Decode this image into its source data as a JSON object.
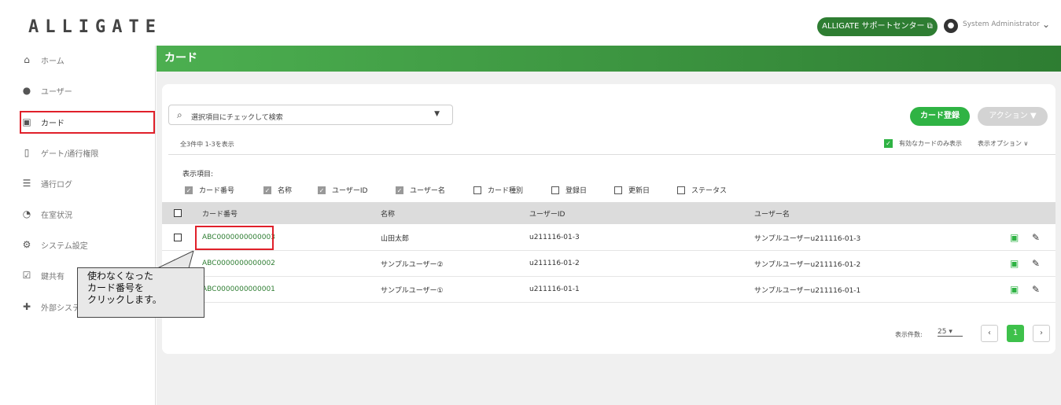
{
  "app": {
    "logo": "ALLIGATE",
    "support": "ALLIGATE サポートセンター ⧉",
    "user_name": "System Administrator"
  },
  "sidebar": {
    "items": [
      {
        "label": "ホーム"
      },
      {
        "label": "ユーザー"
      },
      {
        "label": "カード"
      },
      {
        "label": "ゲート/通行権限"
      },
      {
        "label": "通行ログ"
      },
      {
        "label": "在室状況"
      },
      {
        "label": "システム設定"
      },
      {
        "label": "鍵共有"
      },
      {
        "label": "外部システム"
      }
    ]
  },
  "page": {
    "title": "カード"
  },
  "search": {
    "placeholder": "選択項目にチェックして検索"
  },
  "buttons": {
    "register": "カード登録",
    "action": "アクション ▼"
  },
  "list": {
    "count_text": "全3件中 1-3を表示",
    "valid_only": "有効なカードのみ表示",
    "display_options": "表示オプション ∨"
  },
  "columns_label": "表示項目:",
  "column_options": [
    {
      "label": "カード番号",
      "checked": true
    },
    {
      "label": "名称",
      "checked": true
    },
    {
      "label": "ユーザーID",
      "checked": true
    },
    {
      "label": "ユーザー名",
      "checked": true
    },
    {
      "label": "カード種別",
      "checked": false
    },
    {
      "label": "登録日",
      "checked": false
    },
    {
      "label": "更新日",
      "checked": false
    },
    {
      "label": "ステータス",
      "checked": false
    }
  ],
  "table": {
    "headers": [
      "カード番号",
      "名称",
      "ユーザーID",
      "ユーザー名"
    ],
    "rows": [
      {
        "card": "ABC0000000000003",
        "name": "山田太郎",
        "uid": "u211116-01-3",
        "uname": "サンプルユーザーu211116-01-3"
      },
      {
        "card": "ABC0000000000002",
        "name": "サンプルユーザー②",
        "uid": "u211116-01-2",
        "uname": "サンプルユーザーu211116-01-2"
      },
      {
        "card": "ABC0000000000001",
        "name": "サンプルユーザー①",
        "uid": "u211116-01-1",
        "uname": "サンプルユーザーu211116-01-1"
      }
    ]
  },
  "callout": {
    "line1": "使わなくなった",
    "line2": "カード番号を",
    "line3": "クリックします。"
  },
  "pagination": {
    "per_page_label": "表示件数:",
    "per_page": "25 ▾",
    "prev": "‹",
    "current": "1",
    "next": "›"
  },
  "colors": {
    "accent": "#2fb344",
    "header": "#3a9a40",
    "highlight": "#e0202a"
  }
}
